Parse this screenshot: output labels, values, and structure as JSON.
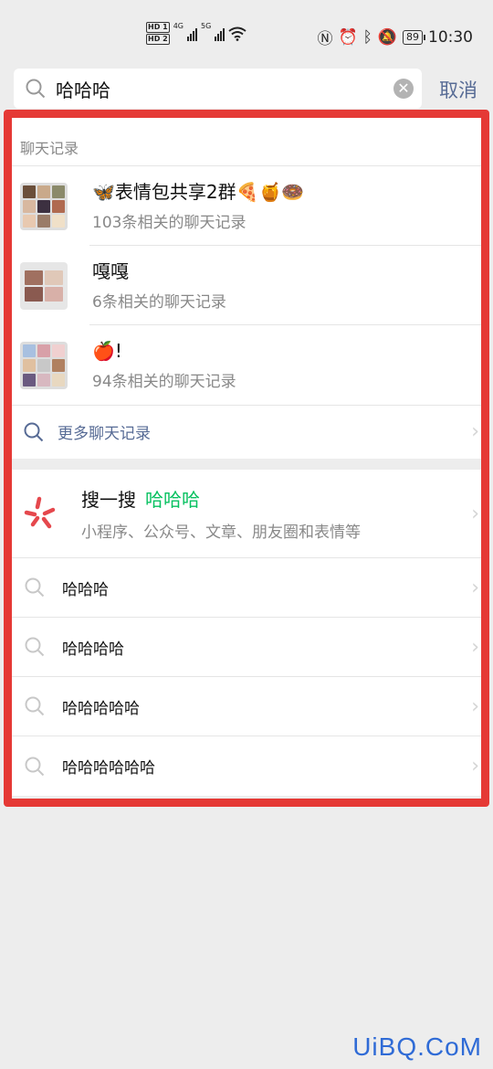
{
  "status_bar": {
    "left_tags": [
      "HD 1",
      "HD 2"
    ],
    "net_1": "4G",
    "net_2": "5G",
    "battery": "89",
    "time": "10:30"
  },
  "search": {
    "query": "哈哈哈",
    "cancel_label": "取消"
  },
  "chat_section": {
    "title": "聊天记录",
    "items": [
      {
        "name": "🦋表情包共享2群🍕🍯🍩",
        "sub": "103条相关的聊天记录"
      },
      {
        "name": "嘎嘎",
        "sub": "6条相关的聊天记录"
      },
      {
        "name": "🍎!",
        "sub": "94条相关的聊天记录"
      }
    ],
    "more_label": "更多聊天记录"
  },
  "souyisou": {
    "title": "搜一搜",
    "keyword": "哈哈哈",
    "sub": "小程序、公众号、文章、朋友圈和表情等"
  },
  "suggestions": [
    "哈哈哈",
    "哈哈哈哈",
    "哈哈哈哈哈",
    "哈哈哈哈哈哈"
  ],
  "watermark": "UiBQ.CoM",
  "colors": {
    "accent_green": "#07c160",
    "link_blue": "#576b95",
    "frame_red": "#e53935"
  }
}
